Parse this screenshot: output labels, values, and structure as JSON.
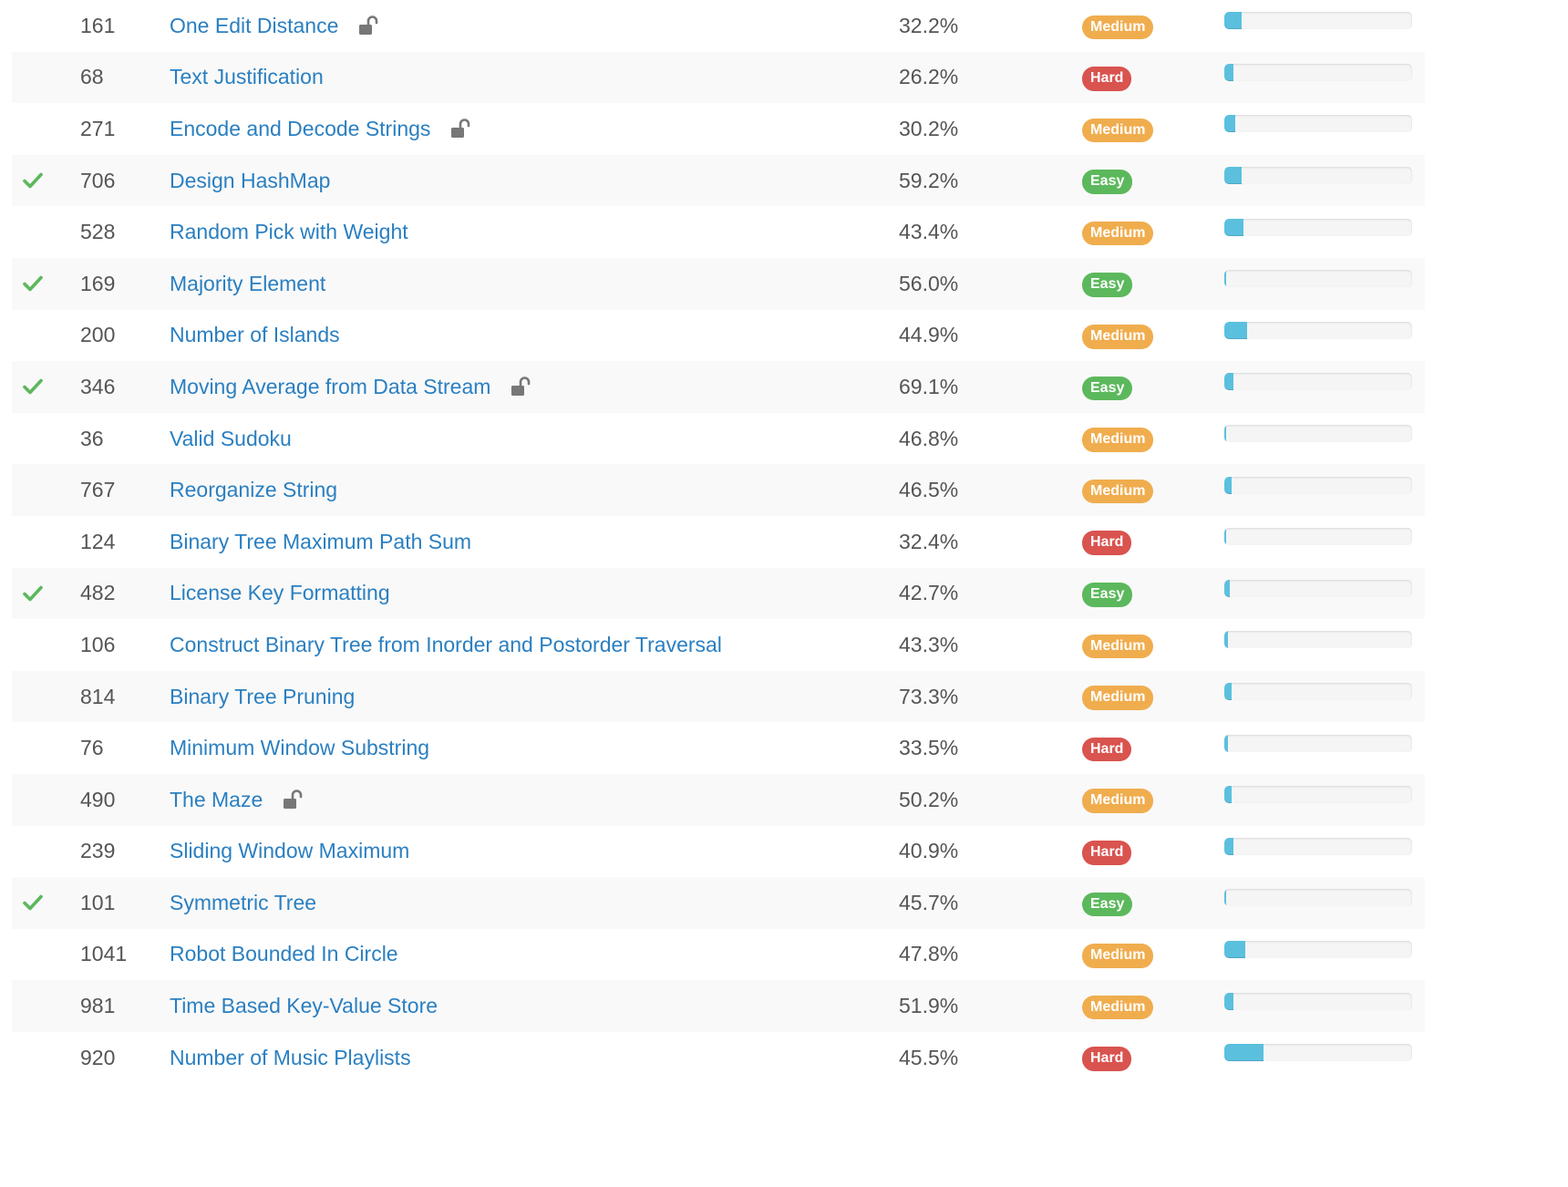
{
  "colors": {
    "link": "#2a7fc1",
    "easy": "#5cb85c",
    "medium": "#f0ad4e",
    "hard": "#d9534f",
    "frequency": "#5bc0de",
    "solved_check": "#5cb85c"
  },
  "problems": [
    {
      "solved": false,
      "number": "161",
      "title": "One Edit Distance",
      "locked": true,
      "acceptance": "32.2%",
      "difficulty": "Medium",
      "frequency": 0.09
    },
    {
      "solved": false,
      "number": "68",
      "title": "Text Justification",
      "locked": false,
      "acceptance": "26.2%",
      "difficulty": "Hard",
      "frequency": 0.05
    },
    {
      "solved": false,
      "number": "271",
      "title": "Encode and Decode Strings",
      "locked": true,
      "acceptance": "30.2%",
      "difficulty": "Medium",
      "frequency": 0.06
    },
    {
      "solved": true,
      "number": "706",
      "title": "Design HashMap",
      "locked": false,
      "acceptance": "59.2%",
      "difficulty": "Easy",
      "frequency": 0.09
    },
    {
      "solved": false,
      "number": "528",
      "title": "Random Pick with Weight",
      "locked": false,
      "acceptance": "43.4%",
      "difficulty": "Medium",
      "frequency": 0.1
    },
    {
      "solved": true,
      "number": "169",
      "title": "Majority Element",
      "locked": false,
      "acceptance": "56.0%",
      "difficulty": "Easy",
      "frequency": 0.01
    },
    {
      "solved": false,
      "number": "200",
      "title": "Number of Islands",
      "locked": false,
      "acceptance": "44.9%",
      "difficulty": "Medium",
      "frequency": 0.12
    },
    {
      "solved": true,
      "number": "346",
      "title": "Moving Average from Data Stream",
      "locked": true,
      "acceptance": "69.1%",
      "difficulty": "Easy",
      "frequency": 0.05
    },
    {
      "solved": false,
      "number": "36",
      "title": "Valid Sudoku",
      "locked": false,
      "acceptance": "46.8%",
      "difficulty": "Medium",
      "frequency": 0.01
    },
    {
      "solved": false,
      "number": "767",
      "title": "Reorganize String",
      "locked": false,
      "acceptance": "46.5%",
      "difficulty": "Medium",
      "frequency": 0.04
    },
    {
      "solved": false,
      "number": "124",
      "title": "Binary Tree Maximum Path Sum",
      "locked": false,
      "acceptance": "32.4%",
      "difficulty": "Hard",
      "frequency": 0.01
    },
    {
      "solved": true,
      "number": "482",
      "title": "License Key Formatting",
      "locked": false,
      "acceptance": "42.7%",
      "difficulty": "Easy",
      "frequency": 0.03
    },
    {
      "solved": false,
      "number": "106",
      "title": "Construct Binary Tree from Inorder and Postorder Traversal",
      "locked": false,
      "acceptance": "43.3%",
      "difficulty": "Medium",
      "frequency": 0.02
    },
    {
      "solved": false,
      "number": "814",
      "title": "Binary Tree Pruning",
      "locked": false,
      "acceptance": "73.3%",
      "difficulty": "Medium",
      "frequency": 0.04
    },
    {
      "solved": false,
      "number": "76",
      "title": "Minimum Window Substring",
      "locked": false,
      "acceptance": "33.5%",
      "difficulty": "Hard",
      "frequency": 0.02
    },
    {
      "solved": false,
      "number": "490",
      "title": "The Maze",
      "locked": true,
      "acceptance": "50.2%",
      "difficulty": "Medium",
      "frequency": 0.04
    },
    {
      "solved": false,
      "number": "239",
      "title": "Sliding Window Maximum",
      "locked": false,
      "acceptance": "40.9%",
      "difficulty": "Hard",
      "frequency": 0.05
    },
    {
      "solved": true,
      "number": "101",
      "title": "Symmetric Tree",
      "locked": false,
      "acceptance": "45.7%",
      "difficulty": "Easy",
      "frequency": 0.01
    },
    {
      "solved": false,
      "number": "1041",
      "title": "Robot Bounded In Circle",
      "locked": false,
      "acceptance": "47.8%",
      "difficulty": "Medium",
      "frequency": 0.11
    },
    {
      "solved": false,
      "number": "981",
      "title": "Time Based Key-Value Store",
      "locked": false,
      "acceptance": "51.9%",
      "difficulty": "Medium",
      "frequency": 0.05
    },
    {
      "solved": false,
      "number": "920",
      "title": "Number of Music Playlists",
      "locked": false,
      "acceptance": "45.5%",
      "difficulty": "Hard",
      "frequency": 0.21
    }
  ]
}
